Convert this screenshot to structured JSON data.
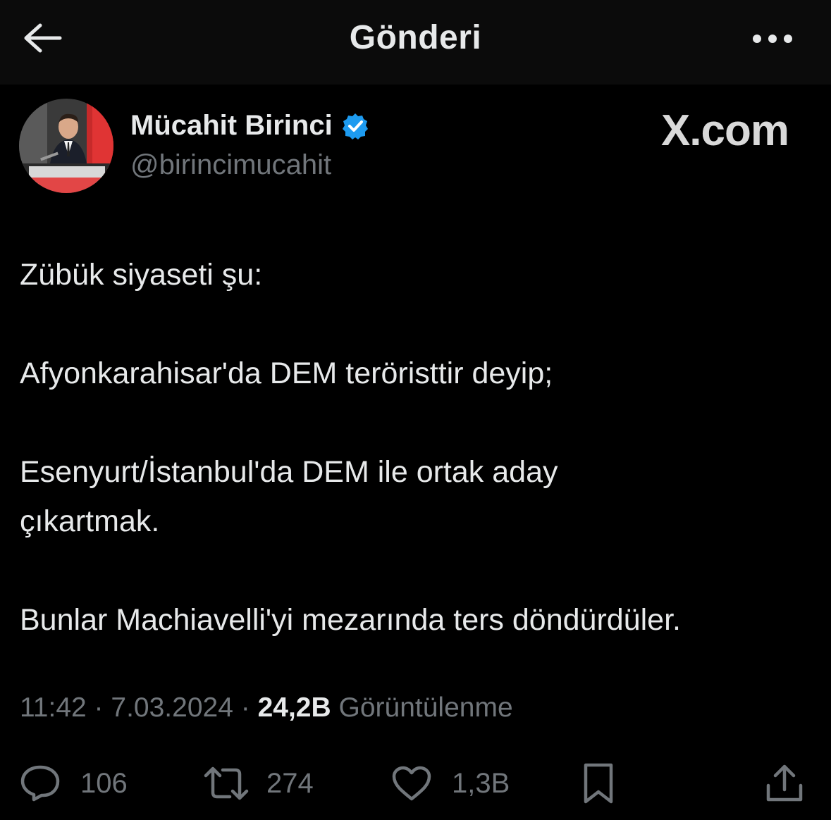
{
  "header": {
    "title": "Gönderi",
    "back_icon": "arrow-left-icon",
    "more_icon": "more-horizontal-icon"
  },
  "author": {
    "name": "Mücahit Birinci",
    "handle": "@birincimucahit",
    "verified": true,
    "verified_color": "#1d9bf0"
  },
  "watermark": "X.com",
  "tweet": {
    "paragraphs": [
      "Zübük siyaseti şu:",
      "Afyonkarahisar'da DEM teröristtir deyip;",
      "Esenyurt/İstanbul'da DEM ile ortak aday çıkartmak.",
      "Bunlar Machiavelli'yi mezarında ters döndürdüler."
    ]
  },
  "meta": {
    "time": "11:42",
    "separator": "·",
    "date": "7.03.2024",
    "views_count": "24,2B",
    "views_label": "Görüntülenme"
  },
  "actions": {
    "reply": {
      "icon": "reply-icon",
      "count": "106"
    },
    "retweet": {
      "icon": "retweet-icon",
      "count": "274"
    },
    "like": {
      "icon": "heart-icon",
      "count": "1,3B"
    },
    "bookmark": {
      "icon": "bookmark-icon"
    },
    "share": {
      "icon": "share-icon"
    }
  },
  "colors": {
    "background": "#000000",
    "header_background": "#0b0b0b",
    "text_primary": "#e7e9ea",
    "text_secondary": "#71767b"
  }
}
